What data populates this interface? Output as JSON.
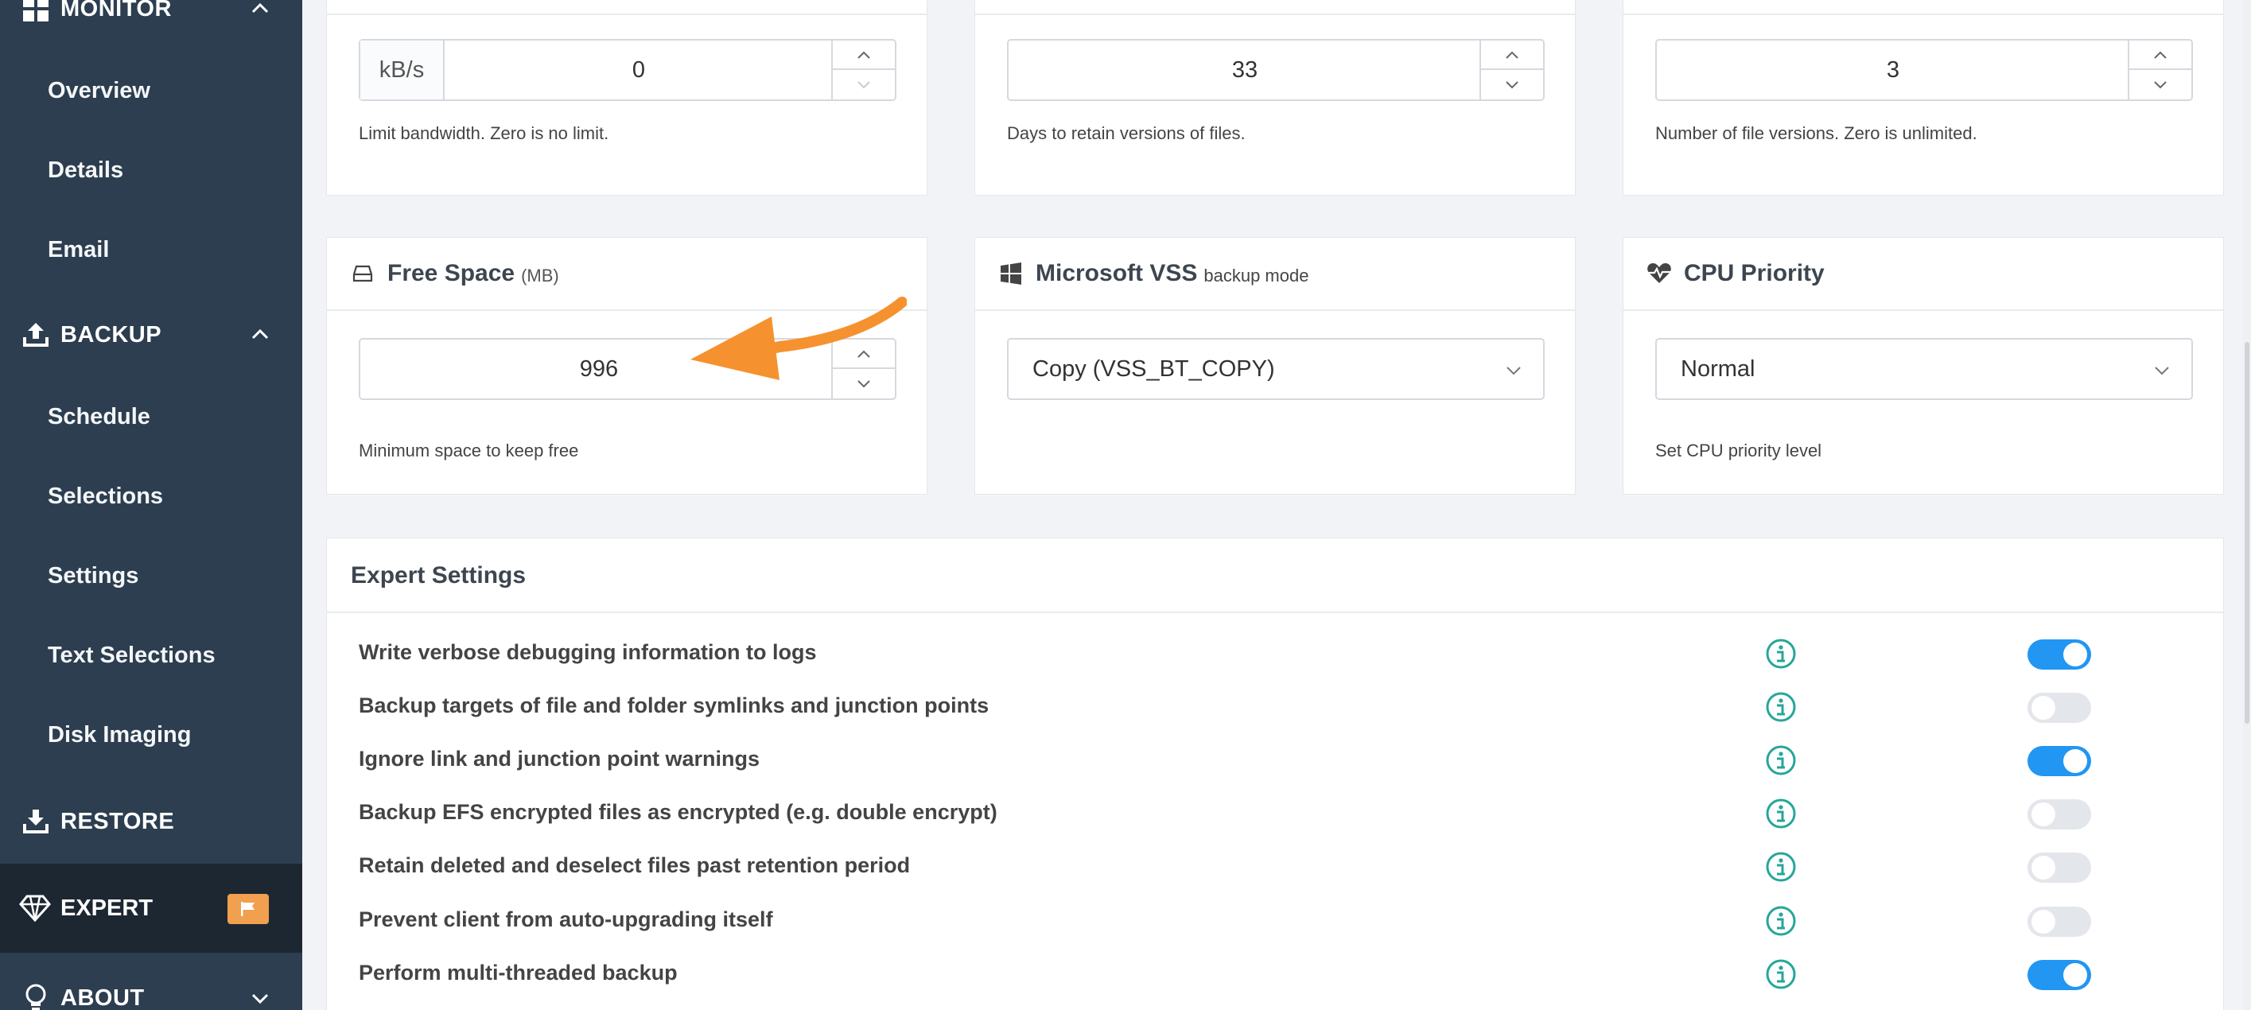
{
  "sidebar": {
    "monitor": {
      "label": "MONITOR"
    },
    "monitor_items": [
      "Overview",
      "Details",
      "Email"
    ],
    "backup": {
      "label": "BACKUP"
    },
    "backup_items": [
      "Schedule",
      "Selections",
      "Settings",
      "Text Selections",
      "Disk Imaging"
    ],
    "restore": {
      "label": "RESTORE"
    },
    "expert": {
      "label": "EXPERT"
    },
    "about": {
      "label": "ABOUT"
    }
  },
  "cards_top": {
    "bandwidth": {
      "unit": "kB/s",
      "value": "0",
      "help": "Limit bandwidth. Zero is no limit."
    },
    "retention": {
      "value": "33",
      "help": "Days to retain versions of files."
    },
    "versions": {
      "value": "3",
      "help": "Number of file versions. Zero is unlimited."
    }
  },
  "free_space": {
    "title": "Free Space",
    "unit": "(MB)",
    "value": "996",
    "help": "Minimum space to keep free"
  },
  "vss": {
    "title": "Microsoft VSS",
    "subtitle": "backup mode",
    "selected": "Copy (VSS_BT_COPY)"
  },
  "cpu": {
    "title": "CPU Priority",
    "selected": "Normal",
    "help": "Set CPU priority level"
  },
  "expert_settings": {
    "title": "Expert Settings",
    "rows": [
      {
        "label": "Write verbose debugging information to logs",
        "on": true
      },
      {
        "label": "Backup targets of file and folder symlinks and junction points",
        "on": false
      },
      {
        "label": "Ignore link and junction point warnings",
        "on": true
      },
      {
        "label": "Backup EFS encrypted files as encrypted (e.g. double encrypt)",
        "on": false
      },
      {
        "label": "Retain deleted and deselect files past retention period",
        "on": false
      },
      {
        "label": "Prevent client from auto-upgrading itself",
        "on": false
      },
      {
        "label": "Perform multi-threaded backup",
        "on": true
      }
    ]
  },
  "colors": {
    "sidebar": "#2c3e50",
    "accent": "#2196f3",
    "info": "#26a69a",
    "arrow": "#f5922f",
    "badge": "#f0a04e"
  }
}
